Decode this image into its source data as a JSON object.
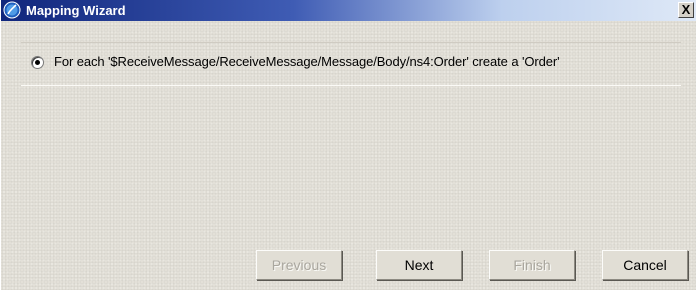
{
  "window": {
    "title": "Mapping Wizard",
    "close_label": "X"
  },
  "options": [
    {
      "label": "For each '$ReceiveMessage/ReceiveMessage/Message/Body/ns4:Order' create a 'Order'",
      "selected": true
    }
  ],
  "buttons": {
    "previous": "Previous",
    "next": "Next",
    "finish": "Finish",
    "cancel": "Cancel"
  },
  "icons": {
    "app": "wizard-app-icon",
    "close": "close-icon"
  },
  "colors": {
    "title_bar_start": "#10267c",
    "title_bar_end": "#dfe9f7",
    "dialog_background": "#e3e0d8",
    "disabled_text": "#a9a69e"
  }
}
